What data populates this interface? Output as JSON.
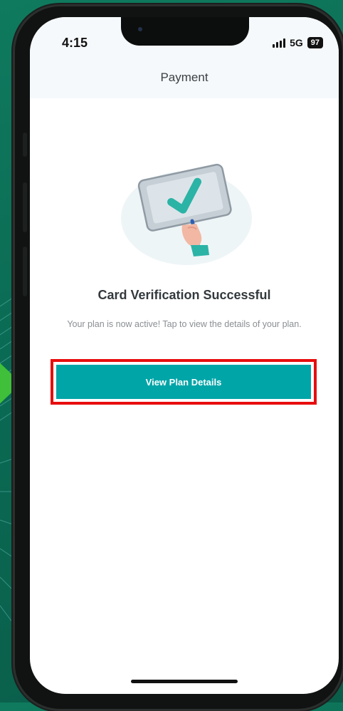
{
  "status_bar": {
    "time": "4:15",
    "network": "5G",
    "battery": "97"
  },
  "header": {
    "title": "Payment"
  },
  "content": {
    "illustration_icon": "hand-holding-checkmark-card",
    "title": "Card Verification Successful",
    "description": "Your plan is now active! Tap to view the details of your plan.",
    "button_label": "View Plan Details"
  },
  "colors": {
    "accent": "#00a5a8",
    "highlight": "#e80d0d",
    "background": "#0a6a53"
  }
}
